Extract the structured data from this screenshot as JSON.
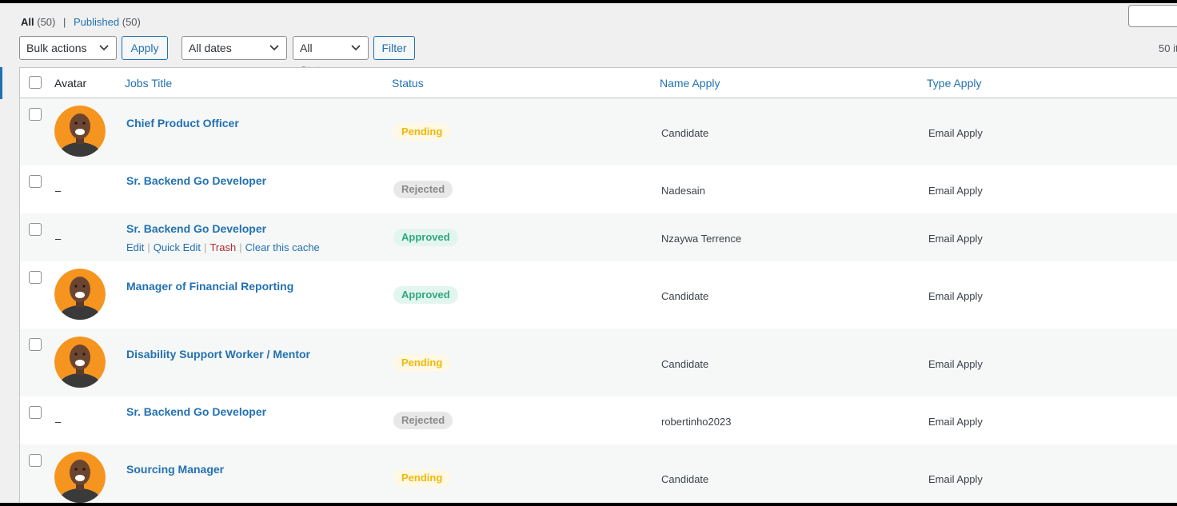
{
  "filters": {
    "all_label": "All",
    "all_count": "(50)",
    "published_label": "Published",
    "published_count": "(50)",
    "bulk_actions": "Bulk actions",
    "apply_label": "Apply",
    "dates": "All dates",
    "status": "All Status",
    "filter_label": "Filter",
    "items_count": "50 it"
  },
  "columns": {
    "avatar": "Avatar",
    "job_title": "Jobs Title",
    "status": "Status",
    "name_apply": "Name Apply",
    "type_apply": "Type Apply"
  },
  "rows": [
    {
      "title": "Chief Product Officer",
      "status": "Pending",
      "name": "Candidate",
      "type": "Email Apply",
      "avatar": true
    },
    {
      "title": "Sr. Backend Go Developer",
      "status": "Rejected",
      "name": "Nadesain",
      "type": "Email Apply",
      "avatar": false,
      "placeholder": "–"
    },
    {
      "title": "Sr. Backend Go Developer",
      "status": "Approved",
      "name": "Nzaywa Terrence",
      "type": "Email Apply",
      "avatar": false,
      "placeholder": "–"
    },
    {
      "title": "Manager of Financial Reporting",
      "status": "Approved",
      "name": "Candidate",
      "type": "Email Apply",
      "avatar": true
    },
    {
      "title": "Disability Support Worker / Mentor",
      "status": "Pending",
      "name": "Candidate",
      "type": "Email Apply",
      "avatar": true
    },
    {
      "title": "Sr. Backend Go Developer",
      "status": "Rejected",
      "name": "robertinho2023",
      "type": "Email Apply",
      "avatar": false,
      "placeholder": "–"
    },
    {
      "title": "Sourcing Manager",
      "status": "Pending",
      "name": "Candidate",
      "type": "Email Apply",
      "avatar": true
    }
  ],
  "row_actions": {
    "edit": "Edit",
    "quick_edit": "Quick Edit",
    "trash": "Trash",
    "clear_cache": "Clear this cache",
    "sep": "|"
  },
  "colors": {
    "accent": "#2271b1",
    "pending": "#f0b90b",
    "rejected": "#8a8a8a",
    "approved": "#2ea87e",
    "trash": "#b32d2e"
  }
}
